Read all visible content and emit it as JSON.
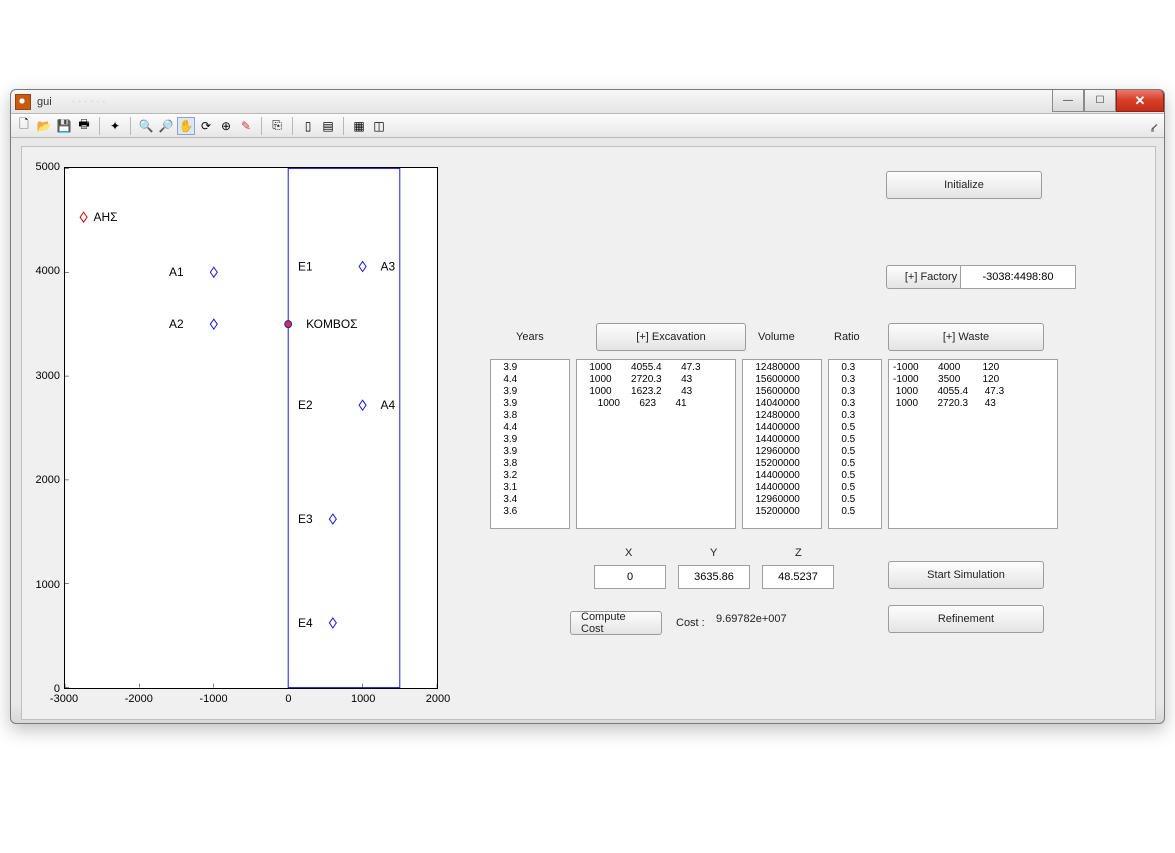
{
  "window": {
    "title": "gui",
    "blurred_caption": "· · · · · ·"
  },
  "buttons": {
    "initialize": "Initialize",
    "factory": "[+] Factory",
    "excavation": "[+] Excavation",
    "waste": "[+] Waste",
    "compute_cost": "Compute Cost",
    "start_simulation": "Start Simulation",
    "refinement": "Refinement"
  },
  "labels": {
    "years": "Years",
    "volume": "Volume",
    "ratio": "Ratio",
    "x": "X",
    "y": "Y",
    "z": "Z",
    "cost": "Cost :"
  },
  "inputs": {
    "factory_value": "-3038:4498:80",
    "x": "0",
    "y": "3635.86",
    "z": "48.5237"
  },
  "cost_value": "9.69782e+007",
  "lists": {
    "years": [
      "3.9",
      "4.4",
      "3.9",
      "3.9",
      "3.8",
      "4.4",
      "3.9",
      "3.9",
      "3.8",
      "3.2",
      "3.1",
      "3.4",
      "3.6"
    ],
    "excavation": [
      "1000       4055.4       47.3",
      "1000       2720.3       43",
      "1000       1623.2       43",
      "   1000       623       41"
    ],
    "volume": [
      "12480000",
      "15600000",
      "15600000",
      "14040000",
      "12480000",
      "14400000",
      "14400000",
      "12960000",
      "15200000",
      "14400000",
      "14400000",
      "12960000",
      "15200000"
    ],
    "ratio": [
      "0.3",
      "0.3",
      "0.3",
      "0.3",
      "0.3",
      "0.5",
      "0.5",
      "0.5",
      "0.5",
      "0.5",
      "0.5",
      "0.5",
      "0.5"
    ],
    "waste": [
      "-1000       4000        120",
      "-1000       3500        120",
      " 1000       4055.4      47.3",
      " 1000       2720.3      43"
    ]
  },
  "chart_data": {
    "type": "scatter",
    "xlim": [
      -3000,
      2000
    ],
    "ylim": [
      0,
      5000
    ],
    "xticks": [
      -3000,
      -2000,
      -1000,
      0,
      1000,
      2000
    ],
    "yticks": [
      0,
      1000,
      2000,
      3000,
      4000,
      5000
    ],
    "blue_rect": {
      "x0": 0,
      "y0": 0,
      "x1": 1500,
      "y1": 5000
    },
    "points": [
      {
        "label": "ΑΗΣ",
        "x": -2750,
        "y": 4530,
        "color": "red"
      },
      {
        "label": "A1",
        "x": -1000,
        "y": 4000,
        "color": "blue",
        "label_dx": -45
      },
      {
        "label": "A2",
        "x": -1000,
        "y": 3500,
        "color": "blue",
        "label_dx": -45
      },
      {
        "label": "ΚΟΜΒΟΣ",
        "x": 0,
        "y": 3500,
        "color": "blue",
        "label_dx": 18,
        "node": true
      },
      {
        "label": "A3",
        "x": 1000,
        "y": 4055,
        "color": "blue",
        "label_dx": 18
      },
      {
        "label": "A4",
        "x": 1000,
        "y": 2720,
        "color": "blue",
        "label_dx": 18
      },
      {
        "label": "E1",
        "x": 600,
        "y": 4055,
        "color": "blue",
        "label_dx": -35,
        "marker": false
      },
      {
        "label": "E2",
        "x": 600,
        "y": 2720,
        "color": "blue",
        "label_dx": -35,
        "marker": false
      },
      {
        "label": "E3",
        "x": 600,
        "y": 1623,
        "color": "blue",
        "label_dx": -35
      },
      {
        "label": "E4",
        "x": 600,
        "y": 623,
        "color": "blue",
        "label_dx": -35
      }
    ]
  }
}
